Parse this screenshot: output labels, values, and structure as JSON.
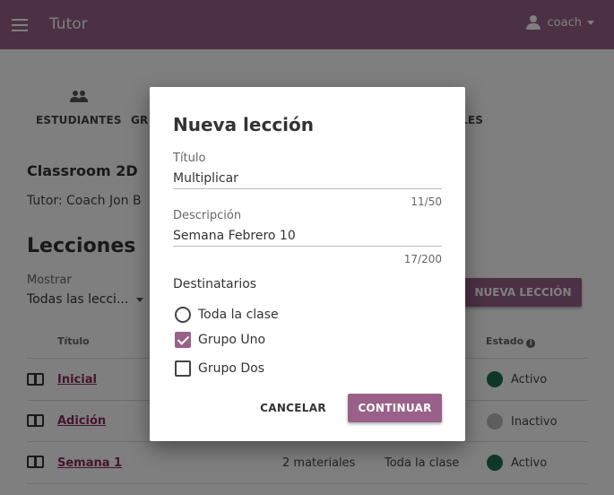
{
  "app": {
    "title": "Tutor",
    "user": "coach"
  },
  "tabs": [
    {
      "label": "ESTUDIANTES",
      "icon": "people-icon"
    },
    {
      "label": "GRUPOS",
      "icon": "groups-icon"
    },
    {
      "label": "LECCIONES",
      "icon": "lessons-icon"
    }
  ],
  "tabs_visible": {
    "first": "ESTUDIANTES",
    "second_fragment": "GR",
    "third_fragment": "LES"
  },
  "classroom": {
    "name": "Classroom 2D",
    "coach": "Tutor: Coach Jon B"
  },
  "lessons_section": {
    "heading": "Lecciones",
    "show_label": "Mostrar",
    "show_value": "Todas las lecci...",
    "new_lesson_button": "NUEVA LECCIÓN",
    "columns": {
      "title": "Título",
      "status": "Estado"
    },
    "rows": [
      {
        "title": "Inicial",
        "materials": "",
        "recipients": "",
        "status": "Activo",
        "active": true
      },
      {
        "title": "Adición",
        "materials": "",
        "recipients": "",
        "status": "Inactivo",
        "active": false
      },
      {
        "title": "Semana 1",
        "materials": "2 materiales",
        "recipients": "Toda la clase",
        "status": "Activo",
        "active": true
      }
    ]
  },
  "modal": {
    "title": "Nueva lección",
    "title_field": {
      "label": "Título",
      "value": "Multiplicar",
      "counter": "11/50"
    },
    "description_field": {
      "label": "Descripción",
      "value": "Semana Febrero 10",
      "counter": "17/200"
    },
    "recipients_label": "Destinatarios",
    "options": [
      {
        "label": "Toda la clase",
        "type": "radio",
        "checked": false
      },
      {
        "label": "Grupo Uno",
        "type": "checkbox",
        "checked": true
      },
      {
        "label": "Grupo Dos",
        "type": "checkbox",
        "checked": false
      }
    ],
    "cancel_label": "CANCELAR",
    "continue_label": "CONTINUAR"
  },
  "colors": {
    "brand": "#996189",
    "link": "#8b2a5c",
    "active_status": "#1f6e4f",
    "inactive_status": "#bdbdbd"
  }
}
